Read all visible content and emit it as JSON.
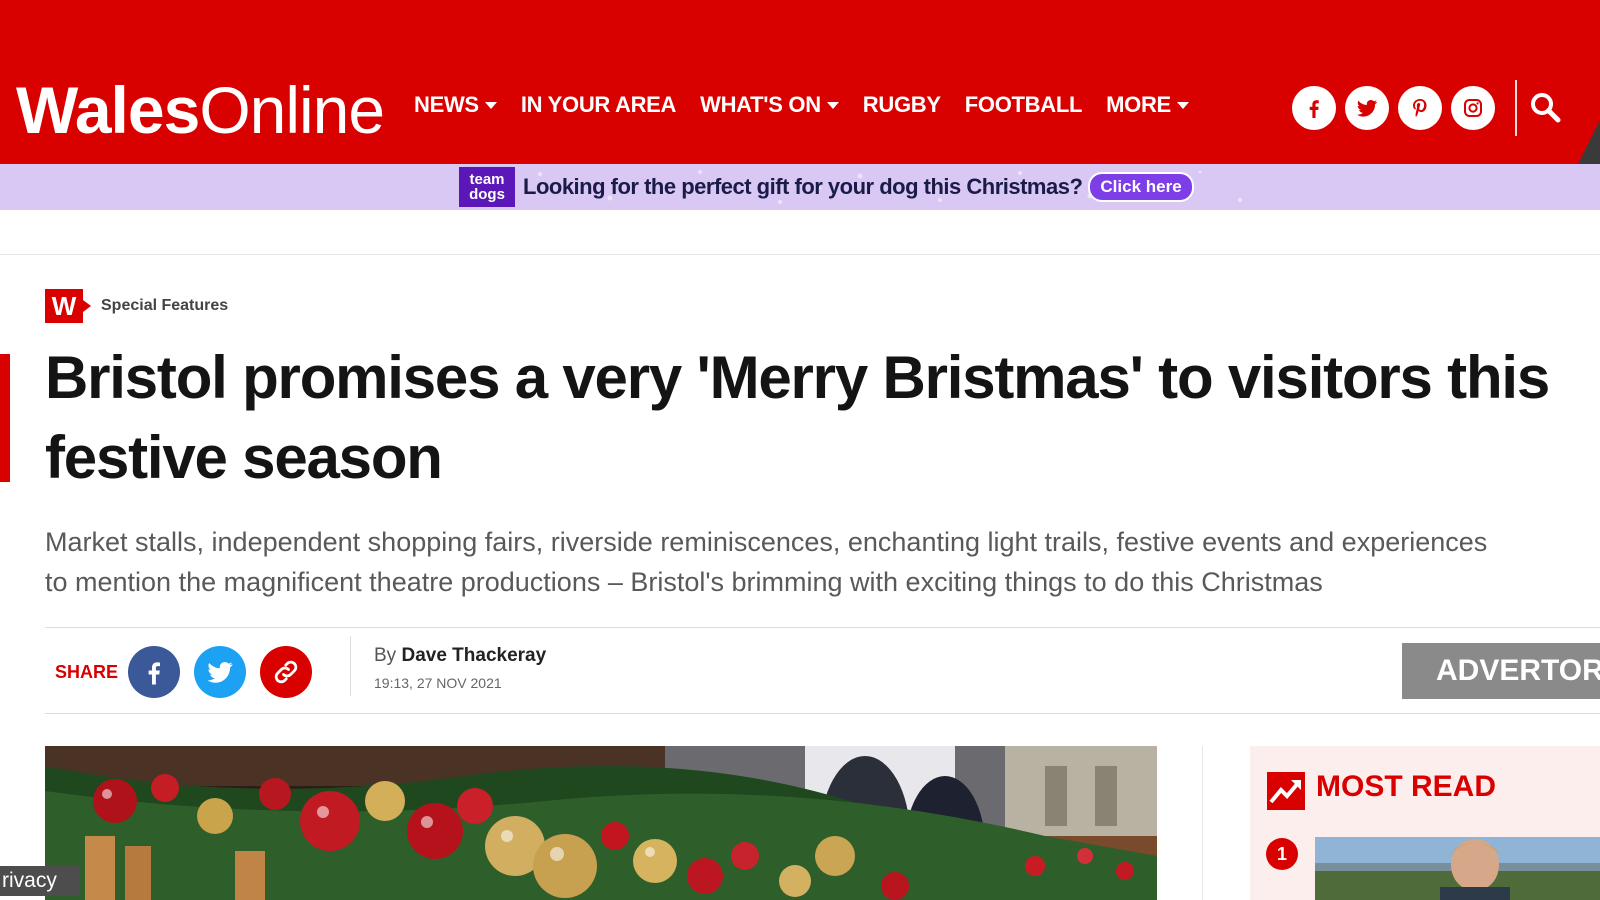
{
  "site": {
    "logo_bold": "Wales",
    "logo_light": "Online",
    "colors": {
      "brand_red": "#d90000",
      "promo_bg": "#d9c8f4",
      "promo_purple": "#7d3ee8"
    }
  },
  "nav": {
    "items": [
      {
        "label": "NEWS",
        "dropdown": true
      },
      {
        "label": "IN YOUR AREA",
        "dropdown": false
      },
      {
        "label": "WHAT'S ON",
        "dropdown": true
      },
      {
        "label": "RUGBY",
        "dropdown": false
      },
      {
        "label": "FOOTBALL",
        "dropdown": false
      },
      {
        "label": "MORE",
        "dropdown": true
      }
    ],
    "socials": [
      "facebook-icon",
      "twitter-icon",
      "pinterest-icon",
      "instagram-icon"
    ],
    "search_icon": "search-icon"
  },
  "promo": {
    "brand_line1": "team",
    "brand_line2": "dogs",
    "text": "Looking for the perfect gift for your dog this Christmas?",
    "button": "Click here"
  },
  "article": {
    "section_badge": "W",
    "section": "Special Features",
    "headline": "Bristol promises a very 'Merry Bristmas' to visitors this festive season",
    "standfirst_line1": "Market stalls, independent shopping fairs, riverside reminiscences, enchanting light trails, festive events and experiences",
    "standfirst_line2": "to mention the magnificent theatre productions – Bristol's brimming with exciting things to do this Christmas",
    "share_label": "SHARE",
    "share_buttons": [
      "facebook-icon",
      "twitter-icon",
      "link-icon"
    ],
    "byline_prefix": "By",
    "author": "Dave Thackeray",
    "timestamp": "19:13, 27 NOV 2021",
    "advertorial": "ADVERTORI"
  },
  "sidebar": {
    "most_read_title": "MOST READ",
    "first_rank": "1"
  },
  "privacy": "rivacy"
}
